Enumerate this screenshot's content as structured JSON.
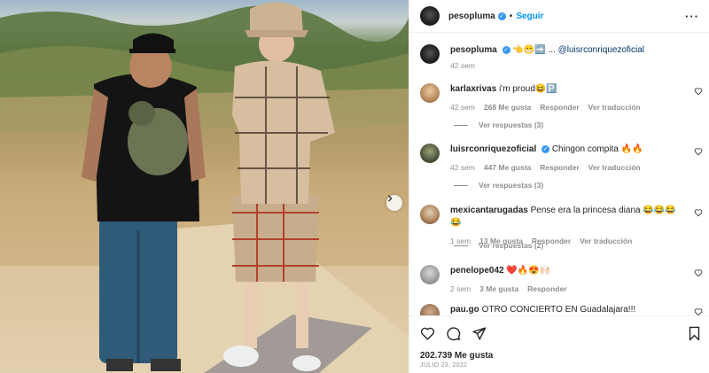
{
  "post": {
    "author": "pesopluma",
    "follow_label": "Seguir",
    "caption_username": "pesopluma",
    "caption_emojis": "👈😁➡️ ...",
    "caption_mention": "@luisrconriquezoficial",
    "caption_time": "42 sem"
  },
  "comments": [
    {
      "username": "karlaxrivas",
      "text": "i'm proud😆🅿️",
      "time": "42 sem",
      "likes": "268 Me gusta",
      "reply": "Responder",
      "translate": "Ver traducción",
      "replies": "Ver respuestas (3)",
      "verified": false
    },
    {
      "username": "luisrconriquezoficial",
      "text": "Chingon compita 🔥🔥",
      "time": "42 sem",
      "likes": "447 Me gusta",
      "reply": "Responder",
      "translate": "Ver traducción",
      "replies": "Ver respuestas (3)",
      "verified": true
    },
    {
      "username": "mexicantarugadas",
      "text": "Pense era la princesa diana 😂😂😂😂",
      "time": "1 sem",
      "likes": "13 Me gusta",
      "reply": "Responder",
      "translate": "Ver traducción",
      "replies": "Ver respuestas (2)",
      "verified": false
    },
    {
      "username": "penelope042",
      "text": "❤️🔥😍🙌🏻",
      "time": "2 sem",
      "likes": "3 Me gusta",
      "reply": "Responder",
      "verified": false
    },
    {
      "username": "pau.go",
      "text": "OTRO CONCIERTO EN Guadalajara!!!",
      "verified": false
    }
  ],
  "footer": {
    "likes": "202.739 Me gusta",
    "date": "JULIO 23, 2022"
  },
  "icons": {
    "verified": "verified-badge-icon",
    "more": "more-options-icon",
    "like": "heart-icon",
    "comment": "comment-icon",
    "share": "share-icon",
    "save": "bookmark-icon",
    "next": "chevron-right-icon"
  },
  "colors": {
    "accent": "#0095f6",
    "verified": "#3897f0",
    "muted": "#8e8e8e"
  }
}
